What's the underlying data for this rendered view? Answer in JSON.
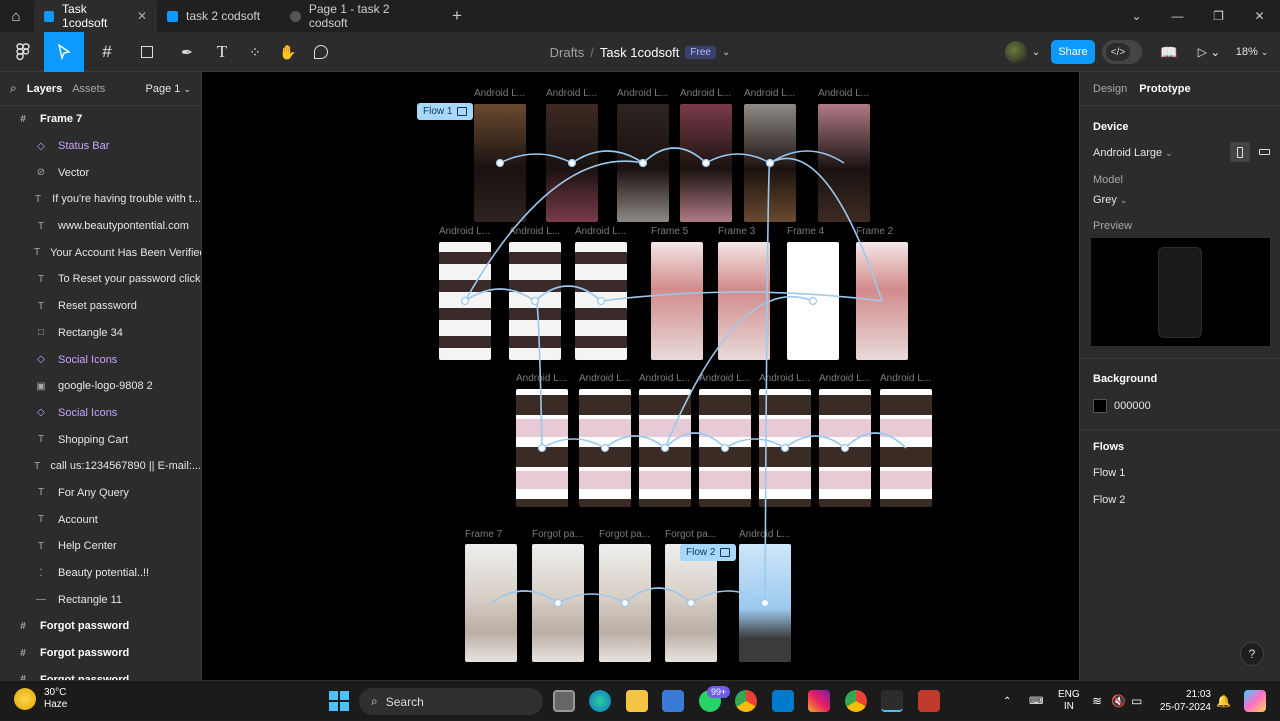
{
  "tabs": [
    {
      "label": "Task 1codsoft",
      "active": true,
      "color": "#0d99ff"
    },
    {
      "label": "task 2 codsoft",
      "active": false,
      "color": "#0d99ff"
    },
    {
      "label": "Page 1 - task 2 codsoft",
      "active": false,
      "color": "#555555"
    }
  ],
  "toolbar": {
    "breadcrumb_parent": "Drafts",
    "breadcrumb_sep": "/",
    "file_name": "Task 1codsoft",
    "plan_badge": "Free",
    "share_label": "Share",
    "zoom": "18%"
  },
  "layers_panel": {
    "tab_layers": "Layers",
    "tab_assets": "Assets",
    "page_selector": "Page 1",
    "items": [
      {
        "label": "Frame 7",
        "kind": "frame",
        "level": 0
      },
      {
        "label": "Status Bar",
        "kind": "component",
        "level": 1
      },
      {
        "label": "Vector",
        "kind": "vector",
        "level": 1
      },
      {
        "label": "If you're having trouble with t...",
        "kind": "text",
        "level": 1
      },
      {
        "label": "www.beautypontential.com",
        "kind": "text",
        "level": 1
      },
      {
        "label": "Your Account Has Been Verified",
        "kind": "text",
        "level": 1
      },
      {
        "label": "To Reset your password click",
        "kind": "text",
        "level": 1
      },
      {
        "label": "Reset password",
        "kind": "text",
        "level": 1
      },
      {
        "label": "Rectangle 34",
        "kind": "rect",
        "level": 1
      },
      {
        "label": "Social Icons",
        "kind": "component",
        "level": 1
      },
      {
        "label": "google-logo-9808 2",
        "kind": "image",
        "level": 1
      },
      {
        "label": "Social Icons",
        "kind": "component",
        "level": 1
      },
      {
        "label": "Shopping Cart",
        "kind": "text",
        "level": 1
      },
      {
        "label": "call us:1234567890 || E-mail:...",
        "kind": "text",
        "level": 1
      },
      {
        "label": "For Any Query",
        "kind": "text",
        "level": 1
      },
      {
        "label": "Account",
        "kind": "text",
        "level": 1
      },
      {
        "label": "Help Center",
        "kind": "text",
        "level": 1
      },
      {
        "label": "Beauty potential..!!",
        "kind": "dotted",
        "level": 1
      },
      {
        "label": "Rectangle 11",
        "kind": "line",
        "level": 1
      },
      {
        "label": "Forgot password",
        "kind": "frame",
        "level": 0
      },
      {
        "label": "Forgot password",
        "kind": "frame",
        "level": 0
      },
      {
        "label": "Forgot password",
        "kind": "frame",
        "level": 0
      }
    ]
  },
  "canvas": {
    "flow_tags": [
      "Flow 1",
      "Flow 2"
    ],
    "frame_labels": {
      "row1": [
        "Android L...",
        "Android L...",
        "Android L...",
        "Android L...",
        "Android L...",
        "Android L..."
      ],
      "row2": [
        "Android L...",
        "Android L...",
        "Android L...",
        "Frame 5",
        "Frame 3",
        "Frame 4",
        "Frame 2"
      ],
      "row3": [
        "Android L...",
        "Android L...",
        "Android L...",
        "Android L...",
        "Android L...",
        "Android L...",
        "Android L..."
      ],
      "row4": [
        "Frame 7",
        "Forgot pa...",
        "Forgot pa...",
        "Forgot pa...",
        "Android L..."
      ]
    }
  },
  "design_panel": {
    "tab_design": "Design",
    "tab_prototype": "Prototype",
    "device_title": "Device",
    "device_value": "Android Large",
    "model_label": "Model",
    "model_value": "Grey",
    "preview_label": "Preview",
    "background_title": "Background",
    "background_value": "000000",
    "flows_title": "Flows",
    "flows": [
      "Flow 1",
      "Flow 2"
    ]
  },
  "taskbar": {
    "temp": "30°C",
    "condition": "Haze",
    "search_label": "Search",
    "whatsapp_badge": "99+",
    "lang_top": "ENG",
    "lang_bottom": "IN",
    "time": "21:03",
    "date": "25-07-2024"
  },
  "colors": {
    "accent": "#0d99ff",
    "component_purple": "#c7a4ff",
    "flow_tag": "#a8d8f8",
    "connector": "#9cc9ee"
  }
}
